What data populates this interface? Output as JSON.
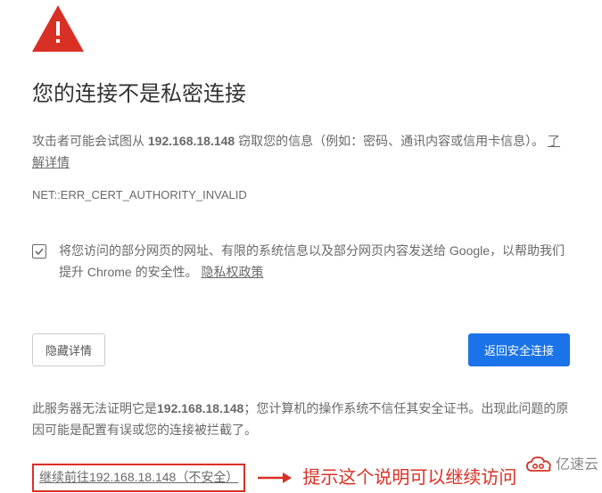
{
  "icon_name": "warning-triangle",
  "heading": "您的连接不是私密连接",
  "warning_prefix": "攻击者可能会试图从 ",
  "warning_ip": "192.168.18.148",
  "warning_suffix": " 窃取您的信息（例如：密码、通讯内容或信用卡信息）。",
  "learn_more": "了解详情",
  "error_code": "NET::ERR_CERT_AUTHORITY_INVALID",
  "opt_in_text": "将您访问的部分网页的网址、有限的系统信息以及部分网页内容发送给 Google，以帮助我们提升 Chrome 的安全性。",
  "privacy_link": "隐私权政策",
  "hide_details_btn": "隐藏详情",
  "back_safety_btn": "返回安全连接",
  "details_prefix": "此服务器无法证明它是",
  "details_ip": "192.168.18.148",
  "details_suffix": "；您计算机的操作系统不信任其安全证书。出现此问题的原因可能是配置有误或您的连接被拦截了。",
  "proceed_link": "继续前往192.168.18.148（不安全）",
  "annotation": "提示这个说明可以继续访问",
  "watermark": "亿速云",
  "colors": {
    "danger": "#d93025",
    "primary": "#1a73e8"
  }
}
